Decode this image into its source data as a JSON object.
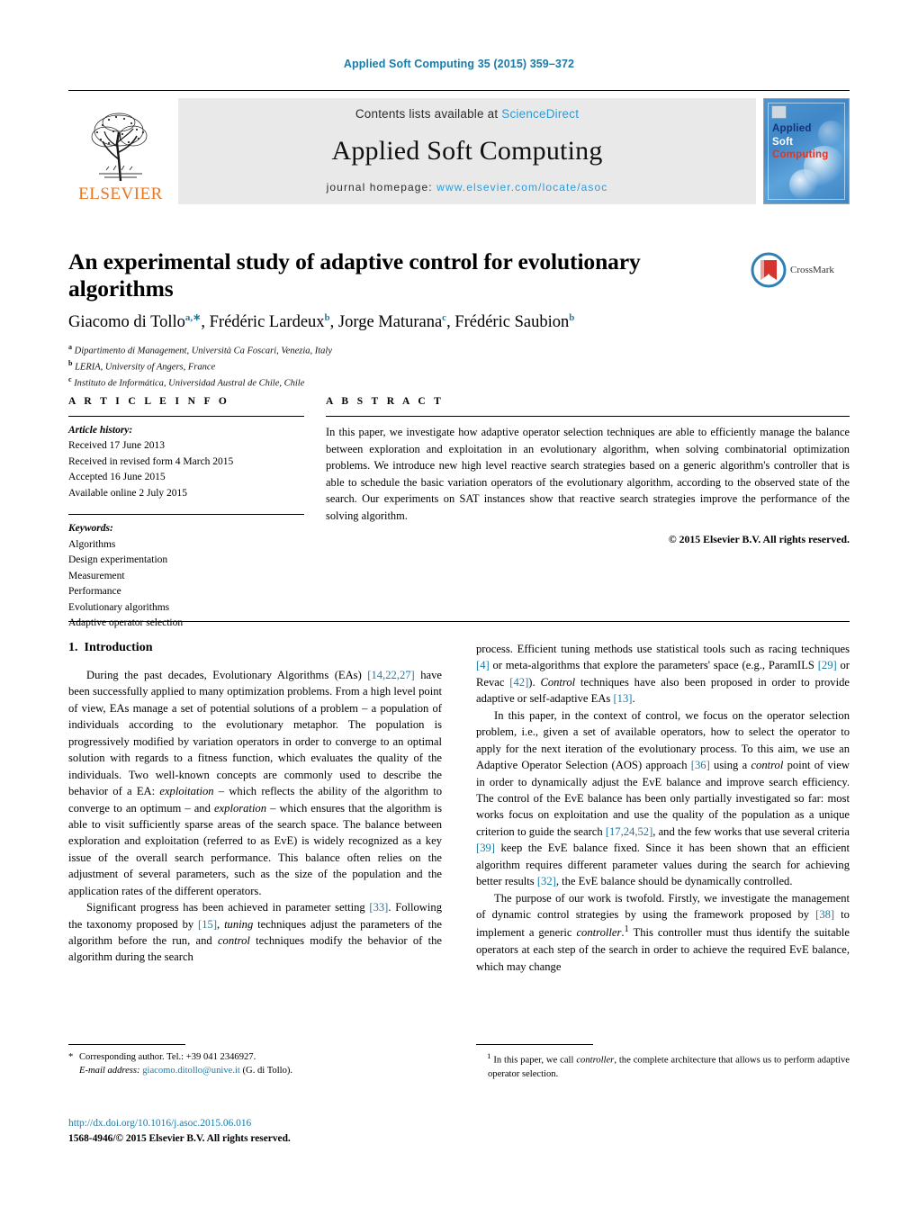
{
  "running_head": "Applied Soft Computing 35 (2015) 359–372",
  "masthead": {
    "contents_prefix": "Contents lists available at ",
    "sciencedirect": "ScienceDirect",
    "journal_name": "Applied Soft Computing",
    "homepage_prefix": "journal homepage: ",
    "homepage_url": "www.elsevier.com/locate/asoc",
    "publisher": "ELSEVIER",
    "cover": {
      "line1": "Applied",
      "line2": "Soft",
      "line3": "Computing"
    },
    "colors": {
      "link": "#2e9bd6",
      "elsevier_orange": "#e87722",
      "band_bg": "#e9e9e9"
    }
  },
  "article": {
    "title": "An experimental study of adaptive control for evolutionary algorithms",
    "crossmark_label": "CrossMark",
    "authors_html": "Giacomo di Tollo<sup>a,∗</sup>, Frédéric Lardeux<sup>b</sup>, Jorge Maturana<sup>c</sup>, Frédéric Saubion<sup>b</sup>",
    "affiliations": [
      {
        "marker": "a",
        "text": "Dipartimento di Management, Università Ca Foscari, Venezia, Italy"
      },
      {
        "marker": "b",
        "text": "LERIA, University of Angers, France"
      },
      {
        "marker": "c",
        "text": "Instituto de Informática, Universidad Austral de Chile, Chile"
      }
    ]
  },
  "info": {
    "heading": "A R T I C L E   I N F O",
    "history_label": "Article history:",
    "history": [
      "Received 17 June 2013",
      "Received in revised form 4 March 2015",
      "Accepted 16 June 2015",
      "Available online 2 July 2015"
    ],
    "keywords_label": "Keywords:",
    "keywords": [
      "Algorithms",
      "Design experimentation",
      "Measurement",
      "Performance",
      "Evolutionary algorithms",
      "Adaptive operator selection"
    ]
  },
  "abstract": {
    "heading": "A B S T R A C T",
    "text": "In this paper, we investigate how adaptive operator selection techniques are able to efficiently manage the balance between exploration and exploitation in an evolutionary algorithm, when solving combinatorial optimization problems. We introduce new high level reactive search strategies based on a generic algorithm's controller that is able to schedule the basic variation operators of the evolutionary algorithm, according to the observed state of the search. Our experiments on SAT instances show that reactive search strategies improve the performance of the solving algorithm.",
    "copyright": "© 2015 Elsevier B.V. All rights reserved."
  },
  "body": {
    "section_number": "1.",
    "section_title": "Introduction",
    "left_paragraphs_html": [
      "During the past decades, Evolutionary Algorithms (EAs) <span class=\"cit\">[14,22,27]</span> have been successfully applied to many optimization problems. From a high level point of view, EAs manage a set of potential solutions of a problem – a population of individuals according to the evolutionary metaphor. The population is progressively modified by variation operators in order to converge to an optimal solution with regards to a fitness function, which evaluates the quality of the individuals. Two well-known concepts are commonly used to describe the behavior of a EA: <span class=\"it\">exploitation</span> – which reflects the ability of the algorithm to converge to an optimum – and <span class=\"it\">exploration</span> – which ensures that the algorithm is able to visit sufficiently sparse areas of the search space. The balance between exploration and exploitation (referred to as EvE) is widely recognized as a key issue of the overall search performance. This balance often relies on the adjustment of several parameters, such as the size of the population and the application rates of the different operators.",
      "Significant progress has been achieved in parameter setting <span class=\"cit\">[33]</span>. Following the taxonomy proposed by <span class=\"cit\">[15]</span>, <span class=\"it\">tuning</span> techniques adjust the parameters of the algorithm before the run, and <span class=\"it\">control</span> techniques modify the behavior of the algorithm during the search"
    ],
    "right_paragraphs_html": [
      "process. Efficient tuning methods use statistical tools such as racing techniques <span class=\"cit\">[4]</span> or meta-algorithms that explore the parameters' space (e.g., ParamILS <span class=\"cit\">[29]</span> or Revac <span class=\"cit\">[42]</span>). <span class=\"it\">Control</span> techniques have also been proposed in order to provide adaptive or self-adaptive EAs <span class=\"cit\">[13]</span>.",
      "In this paper, in the context of control, we focus on the operator selection problem, i.e., given a set of available operators, how to select the operator to apply for the next iteration of the evolutionary process. To this aim, we use an Adaptive Operator Selection (AOS) approach <span class=\"cit\">[36]</span> using a <span class=\"it\">control</span> point of view in order to dynamically adjust the EvE balance and improve search efficiency. The control of the EvE balance has been only partially investigated so far: most works focus on exploitation and use the quality of the population as a unique criterion to guide the search <span class=\"cit\">[17,24,52]</span>, and the few works that use several criteria <span class=\"cit\">[39]</span> keep the EvE balance fixed. Since it has been shown that an efficient algorithm requires different parameter values during the search for achieving better results <span class=\"cit\">[32]</span>, the EvE balance should be dynamically controlled.",
      "The purpose of our work is twofold. Firstly, we investigate the management of dynamic control strategies by using the framework proposed by <span class=\"cit\">[38]</span> to implement a generic <span class=\"it\">controller</span>.<sup>1</sup> This controller must thus identify the suitable operators at each step of the search in order to achieve the required EvE balance, which may change"
    ]
  },
  "footnotes": {
    "corresponding_html": "<span class=\"star\">*</span> Corresponding author. Tel.: +39 041 2346927.",
    "email_label": "E-mail address:",
    "email": "giacomo.ditollo@unive.it",
    "email_suffix": "(G. di Tollo).",
    "note1_html": "<sup>1</sup> In this paper, we call <span class=\"it\">controller</span>, the complete architecture that allows us to perform adaptive operator selection."
  },
  "footer": {
    "doi": "http://dx.doi.org/10.1016/j.asoc.2015.06.016",
    "issn_line": "1568-4946/© 2015 Elsevier B.V. All rights reserved."
  }
}
